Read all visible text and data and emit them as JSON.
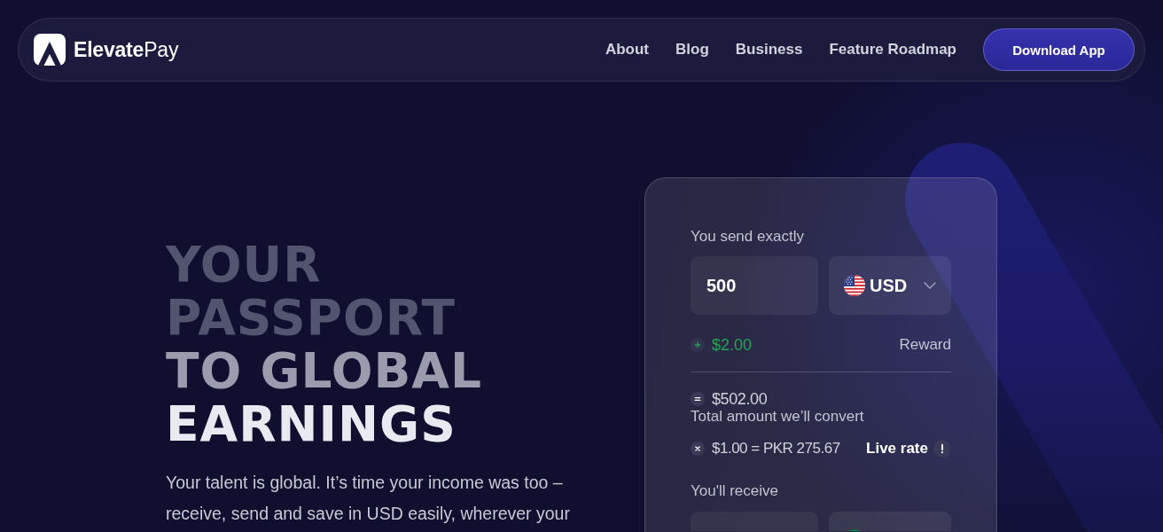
{
  "nav": {
    "brand": "**Elevate**Pay",
    "links": [
      "About",
      "Blog",
      "Business",
      "Feature Roadmap"
    ],
    "cta": "Download App"
  },
  "hero": {
    "heading": [
      {
        "text": "YOUR",
        "color": "#535470"
      },
      {
        "text": "PASSPORT",
        "color": "#535470"
      },
      {
        "text": "TO GLOBAL",
        "color": "#9b9bae"
      },
      {
        "text": "EARNINGS",
        "color": "#e9e9f1"
      }
    ],
    "description": "Your talent is global. It’s time your income was too – receive, send and save in USD easily, wherever your"
  },
  "converter": {
    "send_label": "You send exactly",
    "send_amount": "500",
    "send_currency": "USD",
    "fee": {
      "amount": "$2.00",
      "label": "Reward"
    },
    "total": {
      "amount": "$502.00",
      "label": "Total amount we’ll convert"
    },
    "rate": {
      "value": "$1.00 = PKR 275.67",
      "label": "Live rate"
    },
    "receive_label": "You'll receive"
  }
}
